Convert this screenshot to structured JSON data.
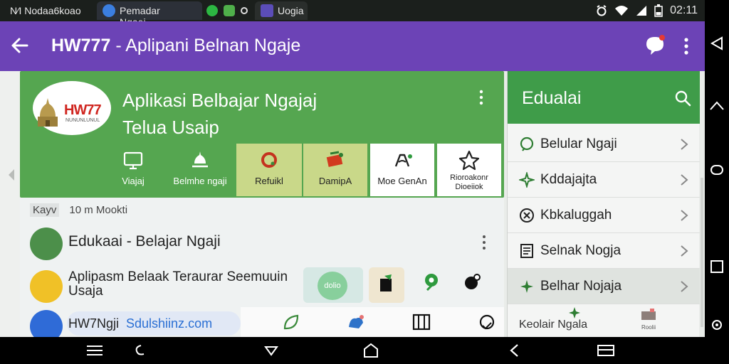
{
  "status_bar": {
    "app_label": "N⁄I Nodaa6koao",
    "tabs": [
      {
        "label": "Pemadar Ngaei…"
      },
      {
        "label": "Uogia"
      }
    ],
    "time": "02:11"
  },
  "app_bar": {
    "title_bold": "HW777",
    "title_rest": " - Aplipani  Belnan Ngaje"
  },
  "hero": {
    "logo_brand": "HW77",
    "logo_sub": "NUNUNLUNUL",
    "title_line1": "Aplikasi Belbajar Ngajaj",
    "title_line2": "Telua Usaip",
    "buttons": [
      {
        "label": "Viajaj"
      },
      {
        "label": "Belmhe ngaji"
      },
      {
        "label": "Refuikl"
      },
      {
        "label": "DamipA"
      },
      {
        "label": "Moe GenAn"
      },
      {
        "label": "Rioroakonr",
        "label2": "Dioeiiok"
      }
    ]
  },
  "list": {
    "chip": "Kayv",
    "meta": "10 m Mookti",
    "items": [
      {
        "title": "Edukaai - Belajar Ngaji"
      },
      {
        "title": "Aplipasm Belaak Teraurar Seemuuin Usaja"
      },
      {
        "title": "HW7Ngji",
        "link": "Sdulshiinz.com"
      }
    ],
    "tile_label": "dolio"
  },
  "panel": {
    "title": "Edualai",
    "items": [
      {
        "label": "Belular Ngaji"
      },
      {
        "label": "Kddajajta"
      },
      {
        "label": "Kbkaluggah"
      },
      {
        "label": "Selnak Nogja"
      },
      {
        "label": "Belhar Nojaja"
      }
    ],
    "footer_label": "Keolair Ngala",
    "footer_small": "Roolii"
  },
  "colors": {
    "app_bar": "#6c43b6",
    "hero_green": "#55a650",
    "panel_header": "#3f9c49",
    "accent_blue": "#2a6fd4"
  }
}
